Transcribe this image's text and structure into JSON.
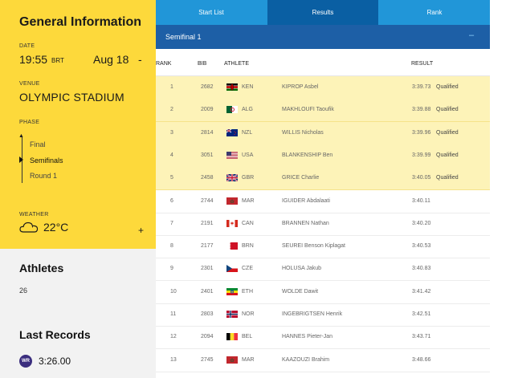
{
  "general": {
    "title": "General Information",
    "date_label": "DATE",
    "time": "19:55",
    "tz": "BRT",
    "date": "Aug 18",
    "dash": "-",
    "venue_label": "VENUE",
    "venue": "OLYMPIC STADIUM",
    "phase_label": "PHASE",
    "phases": [
      "Final",
      "Semifinals",
      "Round 1"
    ],
    "active_phase": "Semifinals",
    "weather_label": "WEATHER",
    "temperature": "22°C",
    "expand": "+"
  },
  "athletes": {
    "title": "Athletes",
    "count": "26"
  },
  "records": {
    "title": "Last Records",
    "badge": "WR",
    "value": "3:26.00",
    "badge_color": "#3b2e7e"
  },
  "tabs": [
    "Start List",
    "Results",
    "Rank"
  ],
  "active_tab": "Results",
  "section": {
    "title": "Semifinal 1",
    "collapse": "–"
  },
  "table": {
    "headers": {
      "rank": "RANK",
      "bib": "BIB",
      "athlete": "ATHLETE",
      "result": "RESULT"
    },
    "rows": [
      {
        "rank": "1",
        "bib": "2682",
        "noc": "KEN",
        "name": "KIPROP Asbel",
        "result": "3:39.73",
        "status": "Qualified"
      },
      {
        "rank": "2",
        "bib": "2009",
        "noc": "ALG",
        "name": "MAKHLOUFI Taoufik",
        "result": "3:39.88",
        "status": "Qualified"
      },
      {
        "rank": "3",
        "bib": "2814",
        "noc": "NZL",
        "name": "WILLIS Nicholas",
        "result": "3:39.96",
        "status": "Qualified"
      },
      {
        "rank": "4",
        "bib": "3051",
        "noc": "USA",
        "name": "BLANKENSHIP Ben",
        "result": "3:39.99",
        "status": "Qualified"
      },
      {
        "rank": "5",
        "bib": "2458",
        "noc": "GBR",
        "name": "GRICE Charlie",
        "result": "3:40.05",
        "status": "Qualified"
      },
      {
        "rank": "6",
        "bib": "2744",
        "noc": "MAR",
        "name": "IGUIDER Abdalaati",
        "result": "3:40.11",
        "status": ""
      },
      {
        "rank": "7",
        "bib": "2191",
        "noc": "CAN",
        "name": "BRANNEN Nathan",
        "result": "3:40.20",
        "status": ""
      },
      {
        "rank": "8",
        "bib": "2177",
        "noc": "BRN",
        "name": "SEUREI Benson Kiplagat",
        "result": "3:40.53",
        "status": ""
      },
      {
        "rank": "9",
        "bib": "2301",
        "noc": "CZE",
        "name": "HOLUSA Jakub",
        "result": "3:40.83",
        "status": ""
      },
      {
        "rank": "10",
        "bib": "2401",
        "noc": "ETH",
        "name": "WOLDE Dawit",
        "result": "3:41.42",
        "status": ""
      },
      {
        "rank": "11",
        "bib": "2803",
        "noc": "NOR",
        "name": "INGEBRIGTSEN Henrik",
        "result": "3:42.51",
        "status": ""
      },
      {
        "rank": "12",
        "bib": "2094",
        "noc": "BEL",
        "name": "HANNES Pieter-Jan",
        "result": "3:43.71",
        "status": ""
      },
      {
        "rank": "13",
        "bib": "2745",
        "noc": "MAR",
        "name": "KAAZOUZI Brahim",
        "result": "3:48.66",
        "status": ""
      }
    ]
  },
  "colors": {
    "sidebar": "#fdd93b",
    "tabs": "#2196d8",
    "active_tab": "#0a5fa3",
    "section": "#1d5fa6",
    "qualified_row": "#fdf3b8"
  }
}
